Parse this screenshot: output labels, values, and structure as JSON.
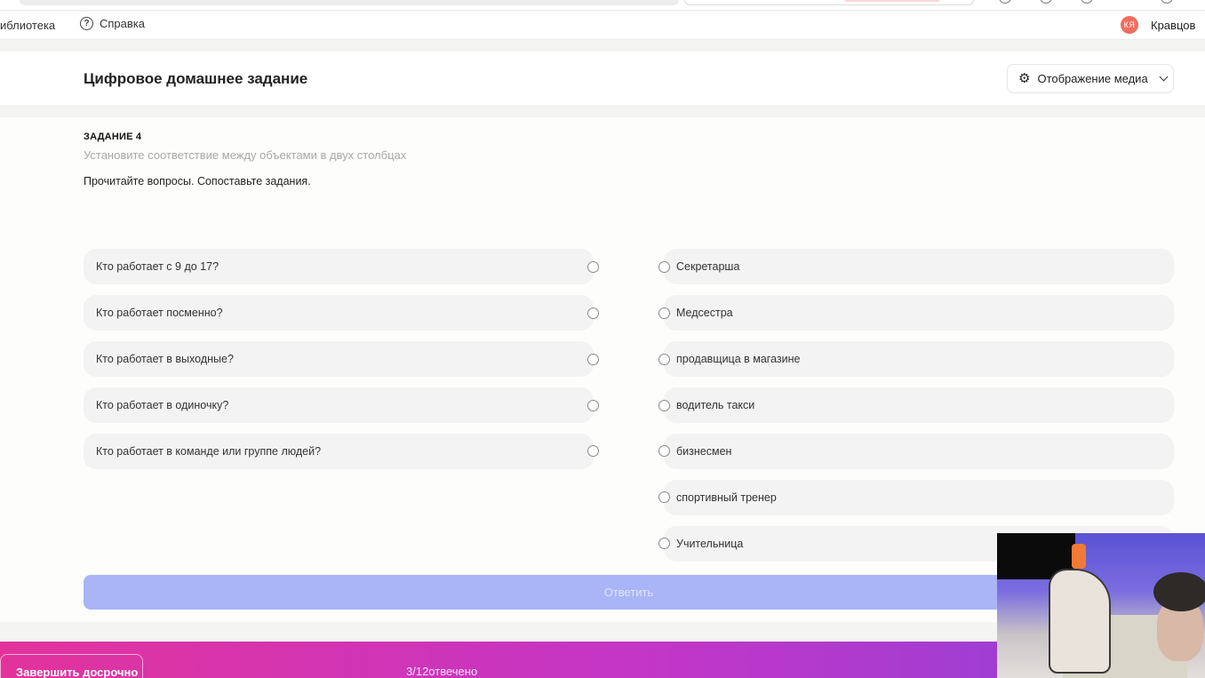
{
  "nav": {
    "library_label": "иблиотека",
    "help_label": "Справка",
    "user_initials": "КЯ",
    "user_name": "Кравцов"
  },
  "header": {
    "title": "Цифровое домашнее задание",
    "media_button_label": "Отображение медиа"
  },
  "task": {
    "number_label": "ЗАДАНИЕ 4",
    "subtitle": "Установите соответствие между объектами в двух столбцах",
    "instruction": "Прочитайте вопросы.  Сопоставьте задания."
  },
  "left_items": [
    "Кто работает с 9 до 17?",
    "Кто работает посменно?",
    "Кто работает в выходные?",
    "Кто работает в одиночку?",
    "Кто работает в команде или группе людей?"
  ],
  "right_items": [
    "Секретарша",
    "Медсестра",
    "продавщица в магазине",
    "водитель такси",
    "бизнесмен",
    "спортивный тренер",
    "Учительница"
  ],
  "answer_button_label": "Ответить",
  "footer": {
    "finish_label": "Завершить досрочно",
    "progress_label": "3/12отвечено"
  },
  "colors": {
    "accent_button": "#a9b5f6",
    "footer_gradient_start": "#e2339c",
    "footer_gradient_end": "#8a43d8",
    "avatar": "#ef6e5e"
  }
}
